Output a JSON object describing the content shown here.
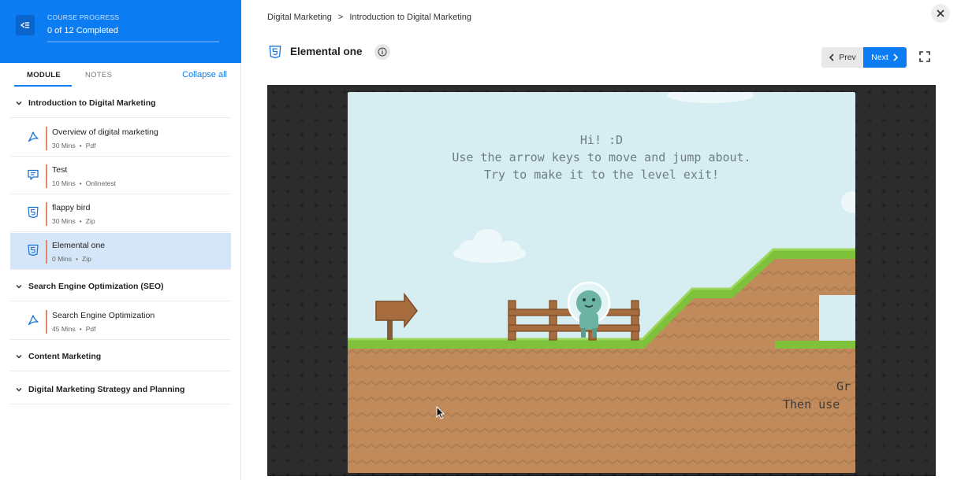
{
  "sidebar": {
    "progress_label": "COURSE PROGRESS",
    "progress_text": "0 of 12 Completed",
    "progress_fraction": 0,
    "tabs": [
      {
        "label": "MODULE",
        "active": true
      },
      {
        "label": "NOTES",
        "active": false
      }
    ],
    "collapse_all": "Collapse all",
    "modules": [
      {
        "title": "Introduction to Digital Marketing",
        "expanded": true,
        "lessons": [
          {
            "name": "Overview of digital marketing",
            "duration": "30 Mins",
            "type": "Pdf",
            "icon": "pdf-icon"
          },
          {
            "name": "Test",
            "duration": "10 Mins",
            "type": "Onlinetest",
            "icon": "chat-test-icon"
          },
          {
            "name": "flappy bird",
            "duration": "30 Mins",
            "type": "Zip",
            "icon": "html5-icon"
          },
          {
            "name": "Elemental one",
            "duration": "0 Mins",
            "type": "Zip",
            "icon": "html5-icon",
            "active": true
          }
        ]
      },
      {
        "title": "Search Engine Optimization (SEO)",
        "expanded": true,
        "lessons": [
          {
            "name": "Search Engine Optimization",
            "duration": "45 Mins",
            "type": "Pdf",
            "icon": "pdf-icon"
          }
        ]
      },
      {
        "title": "Content Marketing",
        "expanded": false
      },
      {
        "title": "Digital Marketing Strategy and Planning",
        "expanded": false
      }
    ]
  },
  "main": {
    "breadcrumb": [
      "Digital Marketing",
      "Introduction to Digital Marketing"
    ],
    "breadcrumb_sep": ">",
    "lesson_title": "Elemental one",
    "prev_label": "Prev",
    "next_label": "Next",
    "game": {
      "lines": [
        "Hi! :D",
        "Use the arrow keys to move and jump about.",
        "Try to make it to the level exit!"
      ],
      "hint_lines": [
        "Gr",
        "Then use"
      ]
    }
  },
  "colors": {
    "accent": "#0b7cf2",
    "active_row": "#d4e6f8",
    "lesson_bar": "#e0876b",
    "grass": "#7dc23a",
    "dirt": "#c08a5b",
    "sky": "#d6eef2"
  }
}
